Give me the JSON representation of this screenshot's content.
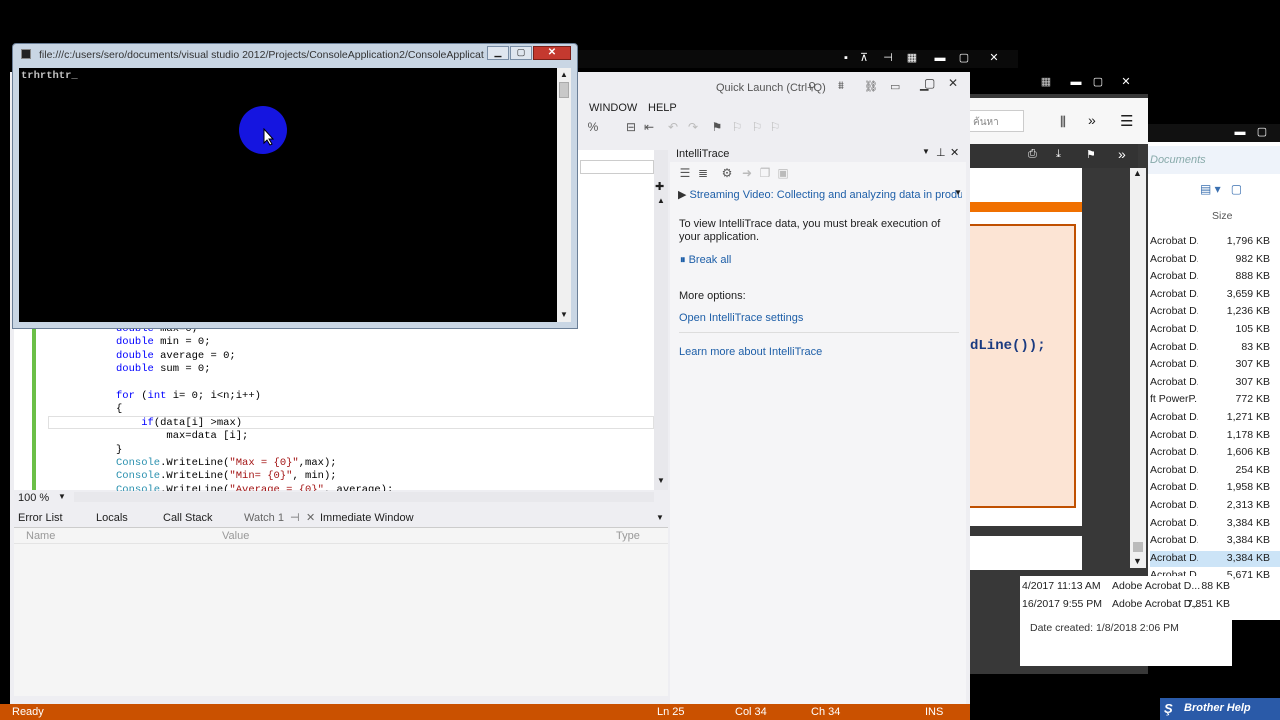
{
  "console": {
    "title": "file:///c:/users/sero/documents/visual studio 2012/Projects/ConsoleApplication2/ConsoleApplicati...",
    "output": "trhrthtr_"
  },
  "vs": {
    "quick_launch": "Quick Launch (Ctrl+Q)",
    "menu": {
      "window": "WINDOW",
      "help": "HELP"
    },
    "zoom": "100 %",
    "code_lines": [
      "double max=0;",
      "double min = 0;",
      "double average = 0;",
      "double sum = 0;",
      "",
      "for (int i= 0; i<n;i++)",
      "{",
      "    if(data[i] >max)",
      "        max=data [i];",
      "}",
      "Console.WriteLine(\"Max = {0}\",max);",
      "Console.WriteLine(\"Min= {0}\", min);",
      "Console.WriteLine(\"Average = {0}\", average);"
    ],
    "bottom_tabs": [
      "Error List",
      "Locals",
      "Call Stack",
      "Watch 1",
      "Immediate Window"
    ],
    "watch_columns": {
      "name": "Name",
      "value": "Value",
      "type": "Type"
    },
    "status": {
      "ready": "Ready",
      "ln": "Ln 25",
      "col": "Col 34",
      "ch": "Ch 34",
      "ins": "INS"
    }
  },
  "intellitrace": {
    "title": "IntelliTrace",
    "video_link": "Streaming Video: Collecting and analyzing data in product",
    "message": "To view IntelliTrace data, you must break execution of your application.",
    "break_all": "Break all",
    "more_options": "More options:",
    "open_settings": "Open IntelliTrace settings",
    "learn_more": "Learn more about IntelliTrace"
  },
  "pdf_viewer": {
    "code_fragment": "dLine());",
    "search_text": "ค้นหา"
  },
  "explorer": {
    "breadcrumb": "Documents",
    "size_header": "Size",
    "rows": [
      {
        "type": "Acrobat D...",
        "size": "1,796 KB"
      },
      {
        "type": "Acrobat D...",
        "size": "982 KB"
      },
      {
        "type": "Acrobat D...",
        "size": "888 KB"
      },
      {
        "type": "Acrobat D...",
        "size": "3,659 KB"
      },
      {
        "type": "Acrobat D...",
        "size": "1,236 KB"
      },
      {
        "type": "Acrobat D...",
        "size": "105 KB"
      },
      {
        "type": "Acrobat D...",
        "size": "83 KB"
      },
      {
        "type": "Acrobat D...",
        "size": "307 KB"
      },
      {
        "type": "Acrobat D...",
        "size": "307 KB"
      },
      {
        "type": "ft PowerP...",
        "size": "772 KB"
      },
      {
        "type": "Acrobat D...",
        "size": "1,271 KB"
      },
      {
        "type": "Acrobat D...",
        "size": "1,178 KB"
      },
      {
        "type": "Acrobat D...",
        "size": "1,606 KB"
      },
      {
        "type": "Acrobat D...",
        "size": "254 KB"
      },
      {
        "type": "Acrobat D...",
        "size": "1,958 KB"
      },
      {
        "type": "Acrobat D...",
        "size": "2,313 KB"
      },
      {
        "type": "Acrobat D...",
        "size": "3,384 KB"
      },
      {
        "type": "Acrobat D...",
        "size": "3,384 KB"
      },
      {
        "type": "Acrobat D...",
        "size": "3,384 KB"
      },
      {
        "type": "Acrobat D...",
        "size": "5,671 KB"
      }
    ],
    "extra_rows": [
      {
        "date": "4/2017 11:13 AM",
        "type": "Adobe Acrobat D...",
        "size": "88 KB"
      },
      {
        "date": "16/2017 9:55 PM",
        "type": "Adobe Acrobat D...",
        "size": "7,851 KB"
      }
    ],
    "date_created": "Date created: 1/8/2018 2:06 PM"
  },
  "taskbar": {
    "brother_help": "Brother Help"
  },
  "colors": {
    "status_bar": "#ca5100",
    "link": "#1e5fa8",
    "pdf_border": "#c05000",
    "pdf_bg": "#fce4d4"
  }
}
